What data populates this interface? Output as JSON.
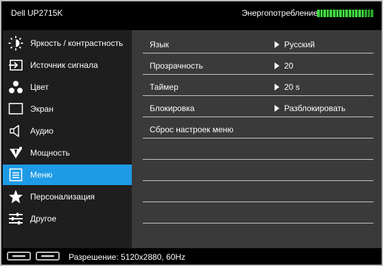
{
  "header": {
    "title": "Dell UP2715K",
    "energy_label": "Энергопотребление",
    "energy_level": 0.85,
    "energy_color": "#3fd63f"
  },
  "sidebar": {
    "active_color": "#1e9be6",
    "items": [
      {
        "label": "Яркость / контрастность",
        "icon": "brightness-icon"
      },
      {
        "label": "Источник сигнала",
        "icon": "input-source-icon"
      },
      {
        "label": "Цвет",
        "icon": "color-icon"
      },
      {
        "label": "Экран",
        "icon": "display-icon"
      },
      {
        "label": "Аудио",
        "icon": "audio-icon"
      },
      {
        "label": "Мощность",
        "icon": "power-icon"
      },
      {
        "label": "Меню",
        "icon": "menu-icon",
        "active": true
      },
      {
        "label": "Персонализация",
        "icon": "star-icon"
      },
      {
        "label": "Другое",
        "icon": "sliders-icon"
      }
    ]
  },
  "main": {
    "rows": [
      {
        "label": "Язык",
        "value": "Русский"
      },
      {
        "label": "Прозрачность",
        "value": "20"
      },
      {
        "label": "Таймер",
        "value": "20 s"
      },
      {
        "label": "Блокировка",
        "value": "Разблокировать"
      },
      {
        "label": "Сброс настроек меню",
        "value": ""
      },
      {
        "label": "",
        "value": ""
      },
      {
        "label": "",
        "value": ""
      },
      {
        "label": "",
        "value": ""
      },
      {
        "label": "",
        "value": ""
      }
    ]
  },
  "footer": {
    "resolution": "Разрешение: 5120x2880, 60Hz",
    "ports": [
      "displayport-icon",
      "displayport-icon"
    ]
  }
}
